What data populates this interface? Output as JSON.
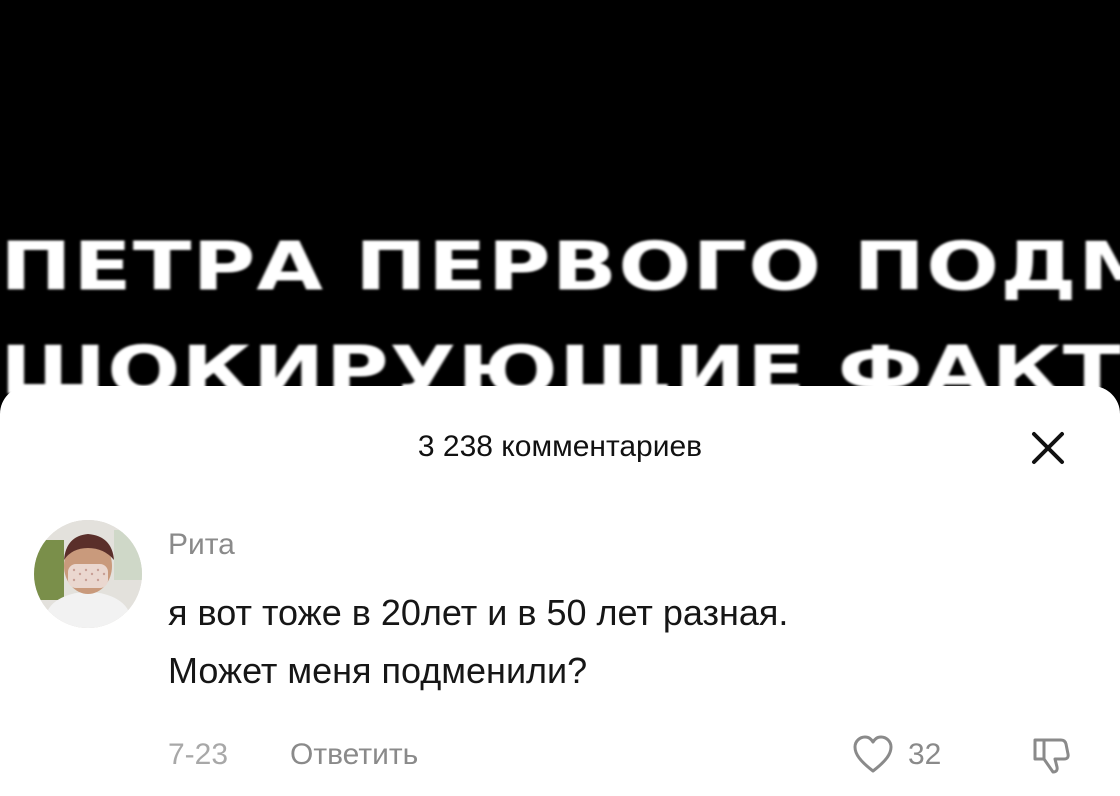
{
  "video": {
    "caption_line1": "ПЕТРА ПЕРВОГО ПОДМЕНИЛИ",
    "caption_line2": "ШОКИРУЮЩИЕ ФАКТЫ"
  },
  "comments_panel": {
    "count_label": "3 238 комментариев",
    "close_icon": "close-icon"
  },
  "comment": {
    "author": "Рита",
    "text_line1": "я вот тоже в 20лет и в 50 лет разная.",
    "text_line2": "Может меня подменили?",
    "date": "7-23",
    "reply_label": "Ответить",
    "like_count": "32",
    "like_icon": "heart-icon",
    "dislike_icon": "thumbs-down-icon"
  },
  "colors": {
    "video_background": "#000000",
    "sheet_background": "#ffffff",
    "muted_text": "#8a8a8a"
  }
}
